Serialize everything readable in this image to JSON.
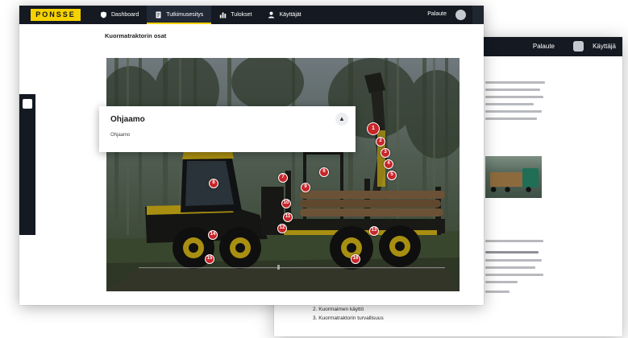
{
  "app": {
    "logo_text": "PONSSE",
    "brand_color": "#f5d100",
    "topbar_color": "#141922",
    "nav": [
      {
        "label": "Dashboard",
        "icon": "shield-icon",
        "active": false
      },
      {
        "label": "Tutkimusesitys",
        "icon": "document-icon",
        "active": true
      },
      {
        "label": "Tulokset",
        "icon": "chart-icon",
        "active": false
      },
      {
        "label": "Käyttäjät",
        "icon": "user-icon",
        "active": false
      }
    ],
    "feedback_label": "Palaute",
    "user_avatar_icon": "avatar-icon"
  },
  "page": {
    "title": "Kuormatraktorin osat"
  },
  "popup": {
    "title": "Ohjaamo",
    "subtitle": "Ohjaamo",
    "collapse_icon": "chevron-up-icon"
  },
  "hotspots": [
    {
      "label": "1"
    },
    {
      "label": "2"
    },
    {
      "label": "3"
    },
    {
      "label": "4"
    },
    {
      "label": "5"
    },
    {
      "label": "6"
    },
    {
      "label": "7"
    },
    {
      "label": "8"
    },
    {
      "label": "9"
    },
    {
      "label": "10"
    },
    {
      "label": "11"
    },
    {
      "label": "12"
    },
    {
      "label": "13"
    },
    {
      "label": "14"
    },
    {
      "label": "15"
    },
    {
      "label": "16"
    }
  ],
  "hotspot_color": "#c8262a",
  "back_window": {
    "feedback_label": "Palaute",
    "user_label": "Käyttäjä",
    "steps": [
      "2. Kuormaimen käyttö",
      "3. Kuormatraktorin turvallisuus"
    ]
  }
}
